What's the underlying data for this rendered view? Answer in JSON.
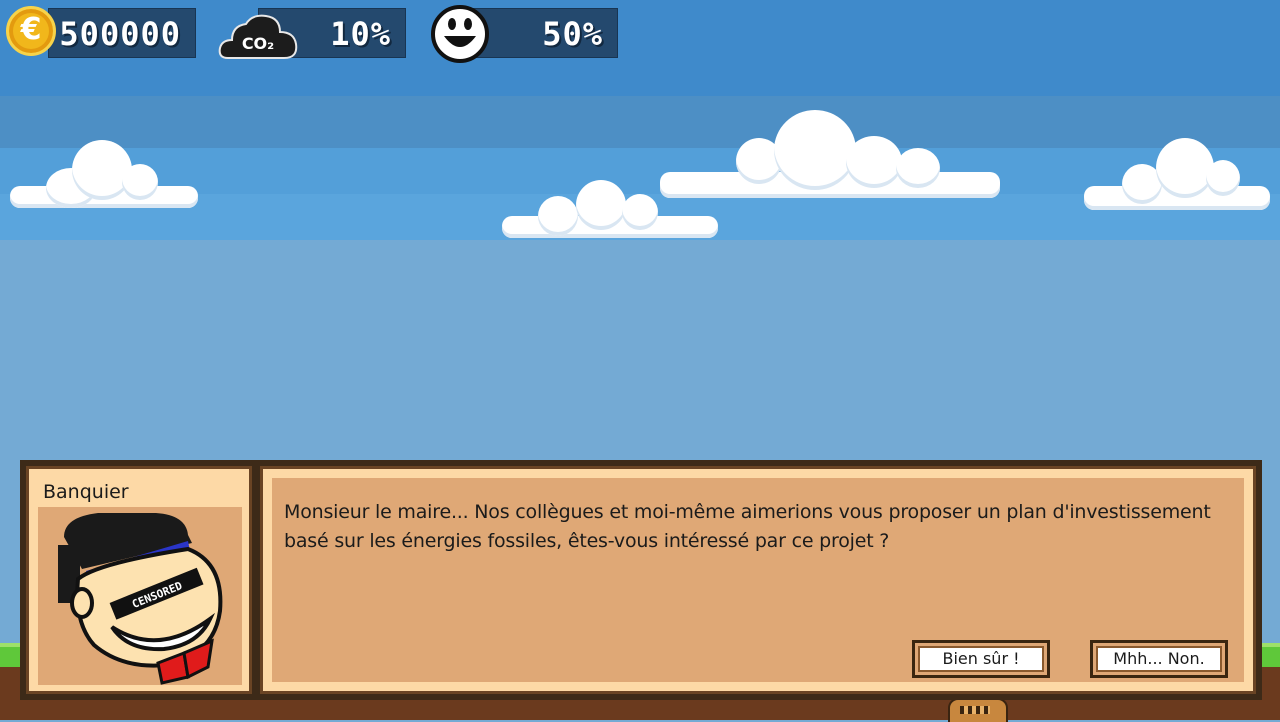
{
  "hud": {
    "money": {
      "value": "500000",
      "icon": "euro-coin-icon",
      "symbol": "€"
    },
    "co2": {
      "value": "10%",
      "icon": "co2-cloud-icon",
      "label": "CO₂"
    },
    "happiness": {
      "value": "50%",
      "icon": "smiley-face-icon"
    }
  },
  "dialog": {
    "speaker": "Banquier",
    "portrait": "banker-portrait",
    "portrait_stamp": "CENSORED",
    "message": "Monsieur le maire... Nos collègues et moi-même aimerions vous proposer un plan d'investissement basé sur les énergies fossiles, êtes-vous intéressé par ce projet ?",
    "choices": [
      {
        "label": "Bien sûr !"
      },
      {
        "label": "Mhh... Non."
      }
    ]
  },
  "colors": {
    "sky": "#74aad4",
    "hud_panel": "#24496e",
    "dialog_frame": "#fdd9a6",
    "dialog_fill": "#dfa876",
    "grass": "#5fc83a"
  }
}
